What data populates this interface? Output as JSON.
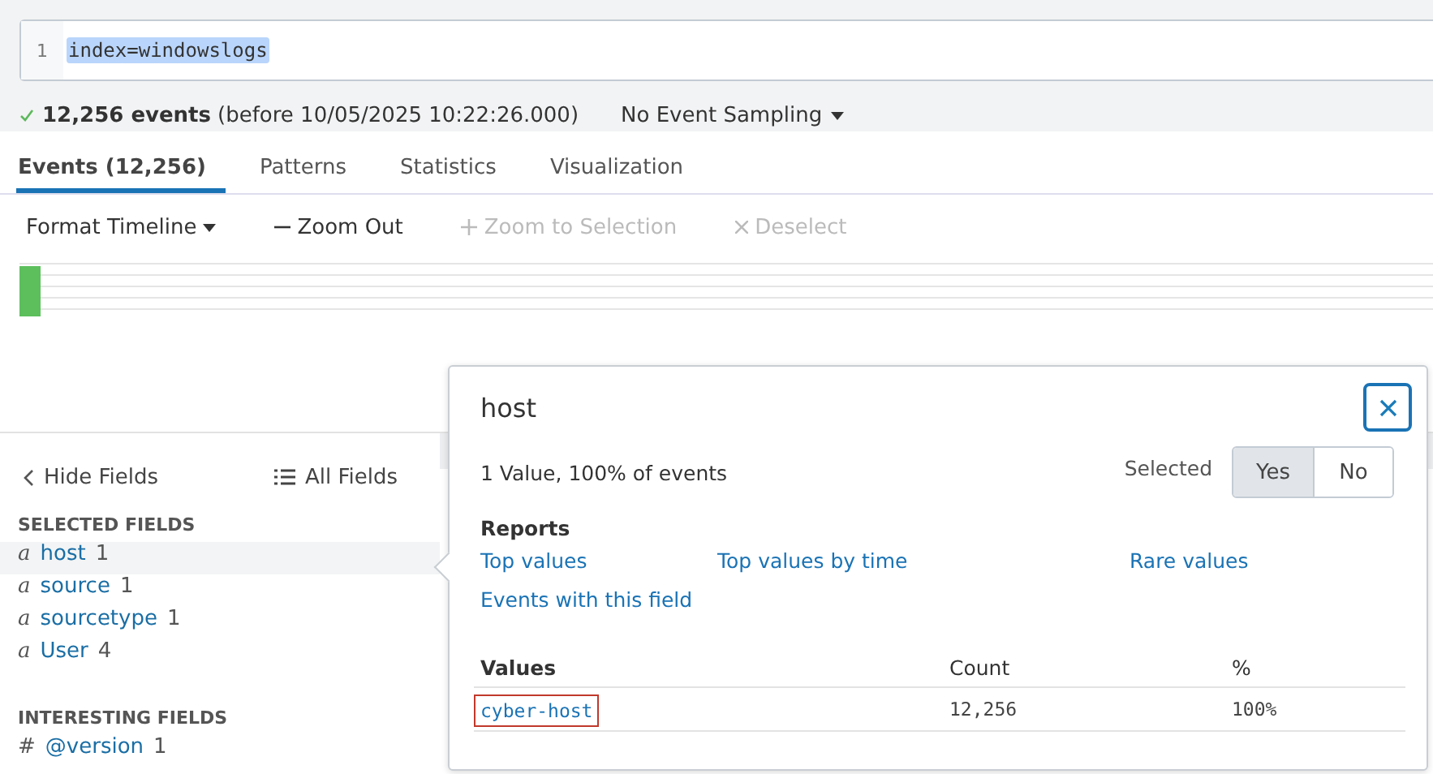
{
  "search": {
    "line_number": "1",
    "query": "index=windowslogs"
  },
  "status": {
    "count": "12,256 events",
    "range": "(before 10/05/2025 10:22:26.000)",
    "sampling": "No Event Sampling"
  },
  "tabs": [
    {
      "label": "Events (12,256)",
      "selected": true
    },
    {
      "label": "Patterns",
      "selected": false
    },
    {
      "label": "Statistics",
      "selected": false
    },
    {
      "label": "Visualization",
      "selected": false
    }
  ],
  "timeline_toolbar": [
    {
      "kind": "dropdown",
      "label": "Format Timeline",
      "disabled": false
    },
    {
      "kind": "minus",
      "label": "Zoom Out",
      "disabled": false
    },
    {
      "kind": "plus",
      "label": "Zoom to Selection",
      "disabled": true
    },
    {
      "kind": "close",
      "label": "Deselect",
      "disabled": true
    }
  ],
  "sidebar": {
    "hide_fields": "Hide Fields",
    "all_fields": "All Fields",
    "sections": [
      {
        "title": "SELECTED FIELDS",
        "fields": [
          {
            "type_symbol": "a",
            "name": "host",
            "count": "1",
            "selected": true
          },
          {
            "type_symbol": "a",
            "name": "source",
            "count": "1",
            "selected": false
          },
          {
            "type_symbol": "a",
            "name": "sourcetype",
            "count": "1",
            "selected": false
          },
          {
            "type_symbol": "a",
            "name": "User",
            "count": "4",
            "selected": false
          }
        ]
      },
      {
        "title": "INTERESTING FIELDS",
        "fields": [
          {
            "type_symbol": "#",
            "name": "@version",
            "count": "1",
            "selected": false
          }
        ]
      }
    ]
  },
  "popup": {
    "title": "host",
    "summary": "1 Value, 100% of events",
    "selected_label": "Selected",
    "toggle": [
      {
        "label": "Yes",
        "selected": true
      },
      {
        "label": "No",
        "selected": false
      }
    ],
    "reports_title": "Reports",
    "reports": [
      "Top values",
      "Top values by time",
      "Rare values",
      "Events with this field"
    ],
    "columns": [
      "Values",
      "Count",
      "%"
    ],
    "rows": [
      {
        "value": "cyber-host",
        "count": "12,256",
        "percent": "100%",
        "outlined": true
      }
    ]
  }
}
